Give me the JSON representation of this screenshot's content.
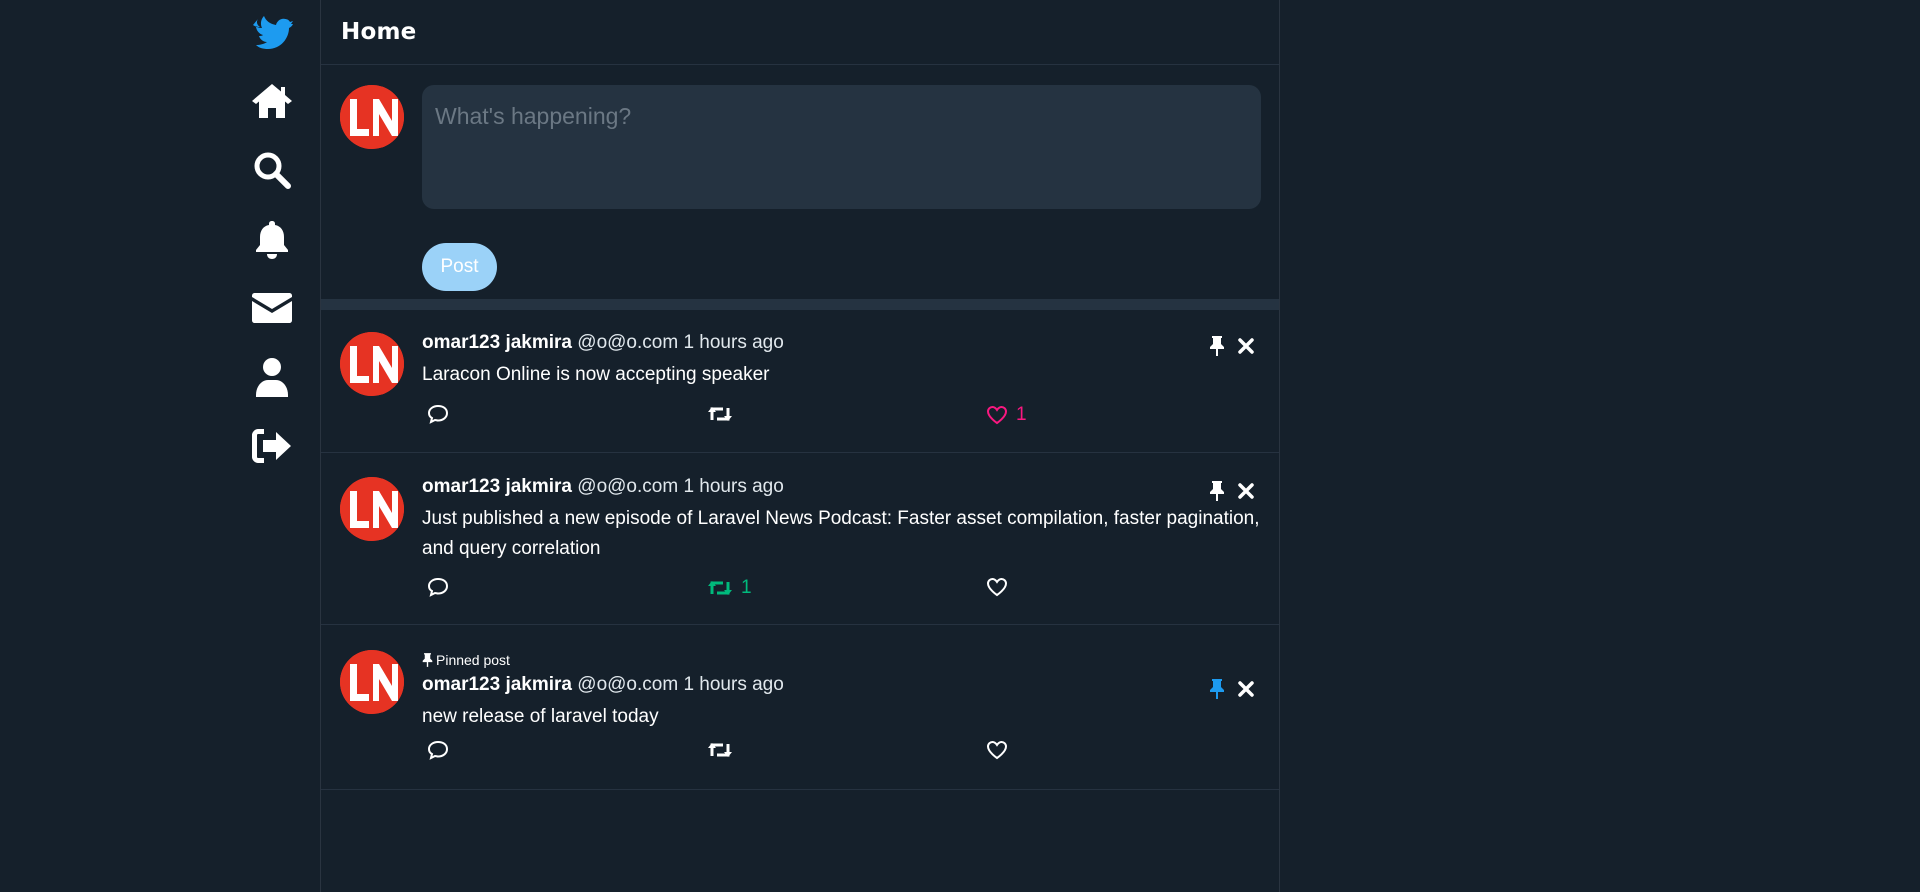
{
  "header": {
    "title": "Home"
  },
  "sidebar": {
    "items": [
      {
        "name": "logo",
        "icon": "bird-icon",
        "color": "#1d9bf0"
      },
      {
        "name": "home",
        "icon": "home-icon"
      },
      {
        "name": "explore",
        "icon": "search-icon"
      },
      {
        "name": "notifications",
        "icon": "bell-icon"
      },
      {
        "name": "messages",
        "icon": "envelope-icon"
      },
      {
        "name": "profile",
        "icon": "user-icon"
      },
      {
        "name": "logout",
        "icon": "logout-icon"
      }
    ]
  },
  "composer": {
    "placeholder": "What's happening?",
    "post_label": "Post",
    "avatar_text": "LN"
  },
  "posts": [
    {
      "pinned_label": "",
      "name": "omar123 jakmira",
      "handle": "@o@o.com",
      "time": "1 hours ago",
      "text": "Laracon Online is now accepting speaker",
      "retweet_count": "",
      "like_count": "1",
      "liked": true,
      "retweeted": false,
      "pinned": false
    },
    {
      "pinned_label": "",
      "name": "omar123 jakmira",
      "handle": "@o@o.com",
      "time": "1 hours ago",
      "text": "Just published a new episode of Laravel News Podcast: Faster asset compilation, faster pagination, and query correlation",
      "retweet_count": "1",
      "like_count": "",
      "liked": false,
      "retweeted": true,
      "pinned": false
    },
    {
      "pinned_label": "Pinned post",
      "name": "omar123 jakmira",
      "handle": "@o@o.com",
      "time": "1 hours ago",
      "text": "new release of laravel today",
      "retweet_count": "",
      "like_count": "",
      "liked": false,
      "retweeted": false,
      "pinned": true
    }
  ],
  "colors": {
    "background": "#15202b",
    "accent": "#1d9bf0",
    "like": "#f91880",
    "retweet": "#00ba7c",
    "post_button": "#9bd2f8"
  }
}
